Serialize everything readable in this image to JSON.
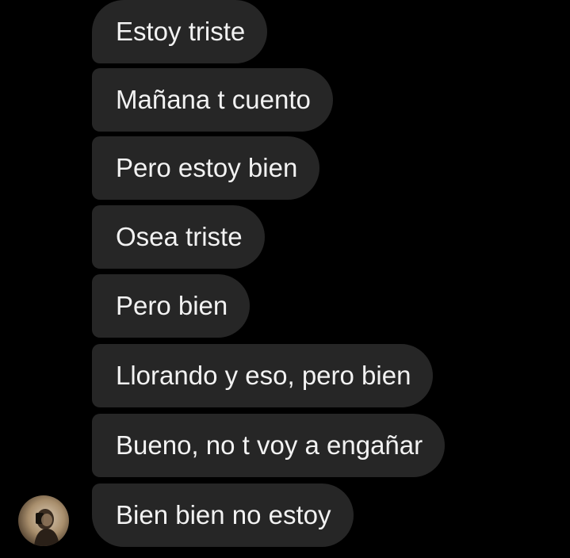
{
  "conversation": {
    "messages": [
      {
        "text": "Estoy triste"
      },
      {
        "text": "Mañana t cuento"
      },
      {
        "text": "Pero estoy bien"
      },
      {
        "text": "Osea triste"
      },
      {
        "text": "Pero bien"
      },
      {
        "text": "Llorando y eso, pero bien"
      },
      {
        "text": "Bueno, no t voy a engañar"
      },
      {
        "text": "Bien bien no estoy"
      }
    ]
  },
  "colors": {
    "background": "#000000",
    "bubble": "#262626",
    "text": "#f2f2f2"
  },
  "icons": {
    "avatar": "sender-profile-photo"
  }
}
